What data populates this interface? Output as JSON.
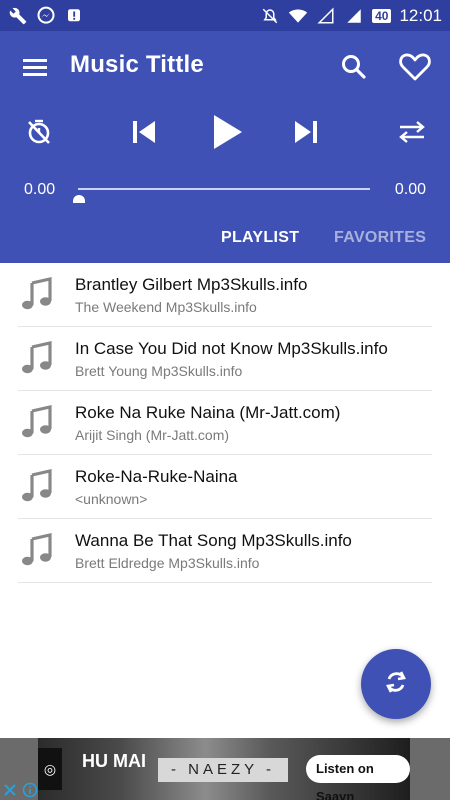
{
  "status_bar": {
    "battery": "40",
    "time": "12:01",
    "icons": [
      "wrench-icon",
      "messenger-icon",
      "notification-icon",
      "mute-icon",
      "wifi-icon",
      "signal-icon",
      "4g-signal-icon",
      "battery-icon"
    ]
  },
  "toolbar": {
    "title": "Music Tittle",
    "icons": [
      "menu-icon",
      "search-icon",
      "heart-icon"
    ]
  },
  "player": {
    "time_elapsed": "0.00",
    "time_total": "0.00",
    "progress": 0,
    "icons": [
      "timer-off-icon",
      "skip-previous-icon",
      "play-icon",
      "skip-next-icon",
      "shuffle-icon"
    ]
  },
  "tabs": {
    "playlist": "PLAYLIST",
    "favorites": "FAVORITES",
    "active": "playlist"
  },
  "songs": [
    {
      "title": "Brantley Gilbert Mp3Skulls.info",
      "artist": "The Weekend Mp3Skulls.info"
    },
    {
      "title": "In Case You Did not Know Mp3Skulls.info",
      "artist": "Brett Young Mp3Skulls.info"
    },
    {
      "title": "Roke Na Ruke Naina (Mr-Jatt.com)",
      "artist": "Arijit Singh (Mr-Jatt.com)"
    },
    {
      "title": "Roke-Na-Ruke-Naina",
      "artist": "<unknown>"
    },
    {
      "title": "Wanna Be That Song Mp3Skulls.info",
      "artist": "Brett Eldredge Mp3Skulls.info"
    }
  ],
  "fab": {
    "icon": "refresh-icon"
  },
  "ad": {
    "left_text": "HU MAI",
    "center_text": "- NAEZY -",
    "button_text": "Listen on Saavn"
  },
  "colors": {
    "primary": "#3f51b5",
    "status_bar": "#2f3fa0",
    "tab_inactive": "#a9b1e0"
  }
}
